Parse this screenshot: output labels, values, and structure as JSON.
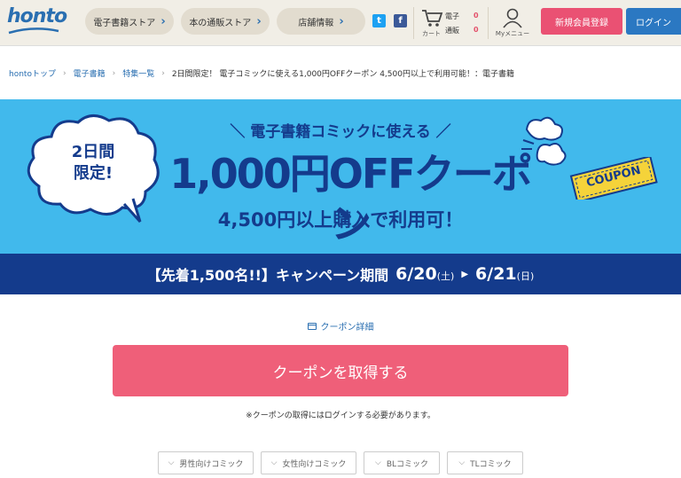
{
  "header": {
    "logo": "honto",
    "nav": [
      "電子書籍ストア",
      "本の通販ストア",
      "店舗情報"
    ],
    "social": {
      "twitter": "t",
      "facebook": "f"
    },
    "cart": {
      "label": "カート",
      "ebook_label": "電子",
      "ebook_count": "0",
      "shop_label": "通販",
      "shop_count": "0"
    },
    "mymenu": "Myメニュー",
    "register": "新規会員登録",
    "login": "ログイン"
  },
  "breadcrumb": {
    "items": [
      "hontoトップ",
      "電子書籍",
      "特集一覧"
    ],
    "current": "2日間限定！ 電子コミックに使える1,000円OFFクーポン 4,500円以上で利用可能！：電子書籍"
  },
  "banner": {
    "bubble_line1": "2日間",
    "bubble_line2": "限定!",
    "subtitle": "＼ 電子書籍コミックに使える ／",
    "headline": "1,000円OFFクーポン",
    "condition": "4,500円以上購入で利用可！",
    "coupon_tag": "COUPON",
    "band_prefix": "【先着1,500名!!】キャンペーン期間",
    "start_date": "6/20",
    "start_day": "(土)",
    "end_date": "6/21",
    "end_day": "(日)",
    "colors": {
      "sky": "#41b9ec",
      "navy": "#143b8c",
      "tag": "#f5d33a"
    }
  },
  "content": {
    "detail_link": "クーポン詳細",
    "coupon_button": "クーポンを取得する",
    "notice": "※クーポンの取得にはログインする必要があります。",
    "categories": [
      "男性向けコミック",
      "女性向けコミック",
      "BLコミック",
      "TLコミック"
    ]
  }
}
